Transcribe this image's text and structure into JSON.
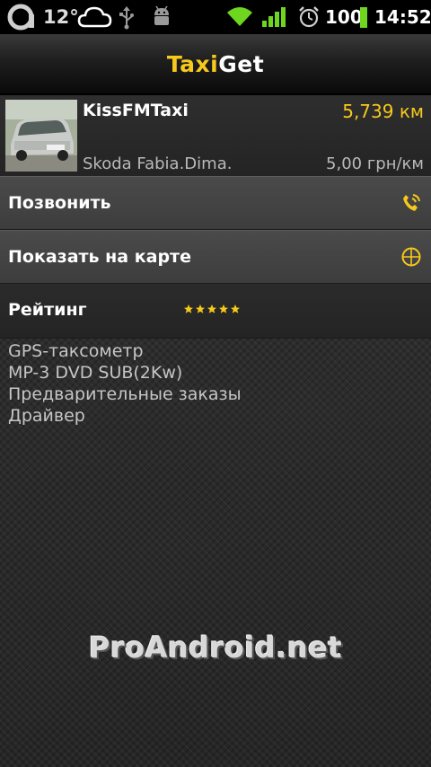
{
  "status_bar": {
    "temperature": "12°",
    "battery": "100",
    "time": "14:52",
    "icons": [
      "a-logo-icon",
      "cloud-icon",
      "usb-icon",
      "android-icon",
      "wifi-icon",
      "signal-icon",
      "alarm-icon",
      "battery-icon"
    ]
  },
  "app": {
    "title_part1": "Taxi",
    "title_part2": "Get"
  },
  "taxi": {
    "name": "KissFMTaxi",
    "distance": "5,739 км",
    "car": "Skoda Fabia.Dima.",
    "price": "5,00 грн/км"
  },
  "actions": {
    "call_label": "Позвонить",
    "map_label": "Показать на карте"
  },
  "rating": {
    "label": "Рейтинг",
    "stars": 5,
    "max_stars": 5
  },
  "features": [
    "GPS-таксометр",
    "MP-3 DVD SUB(2Kw)",
    "Предварительные заказы",
    "Драйвер"
  ],
  "watermark": "ProAndroid.net",
  "colors": {
    "accent": "#f7c91b",
    "row_bg": "#454545",
    "background": "#2a2a2a"
  }
}
